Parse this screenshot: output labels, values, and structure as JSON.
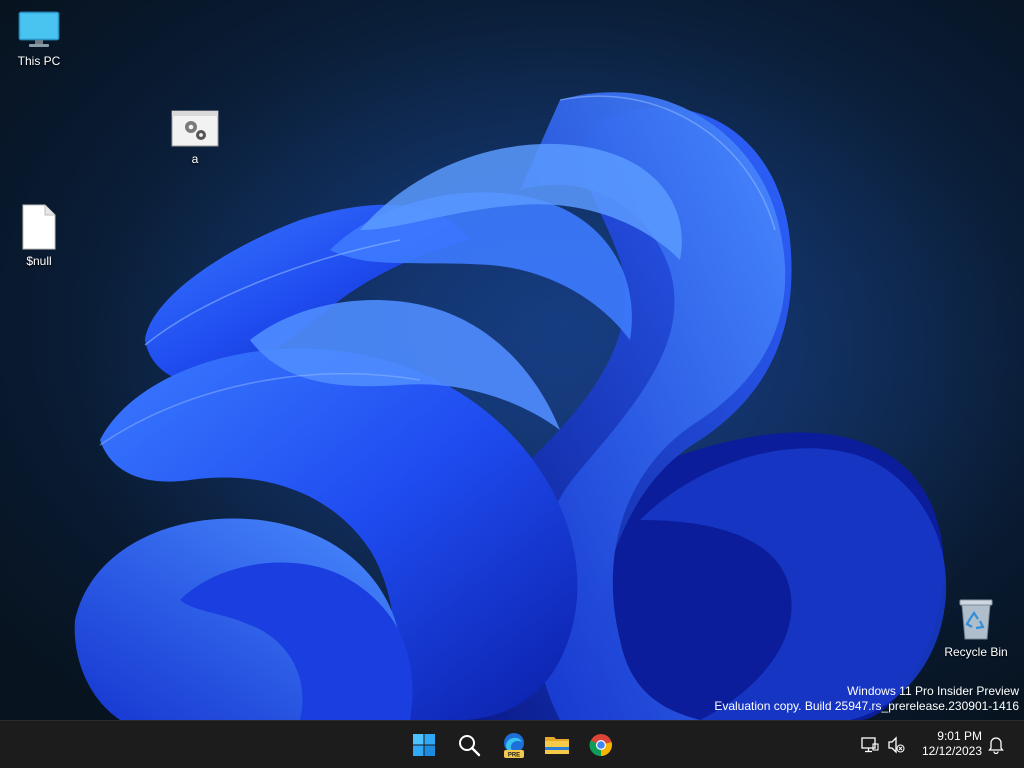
{
  "desktop": {
    "icons": [
      {
        "label": "This PC",
        "icon": "monitor-icon"
      },
      {
        "label": "a",
        "icon": "settings-window-icon"
      },
      {
        "label": "$null",
        "icon": "blank-file-icon"
      },
      {
        "label": "Recycle Bin",
        "icon": "recycle-bin-icon"
      }
    ],
    "watermark": {
      "line1": "Windows 11 Pro Insider Preview",
      "line2": "Evaluation copy. Build 25947.rs_prerelease.230901-1416"
    }
  },
  "taskbar": {
    "apps": [
      {
        "name": "Start",
        "icon": "windows-start-icon"
      },
      {
        "name": "Search",
        "icon": "search-icon"
      },
      {
        "name": "Microsoft Edge Preview",
        "icon": "edge-pre-icon",
        "badge": "PRE"
      },
      {
        "name": "File Explorer",
        "icon": "folder-icon"
      },
      {
        "name": "Google Chrome",
        "icon": "chrome-icon"
      }
    ],
    "tray": {
      "time": "9:01 PM",
      "date": "12/12/2023"
    }
  },
  "colors": {
    "taskbar_bg": "#1c1c1c",
    "wallpaper_dark": "#091a30",
    "bloom_blue": "#1f4fff"
  }
}
